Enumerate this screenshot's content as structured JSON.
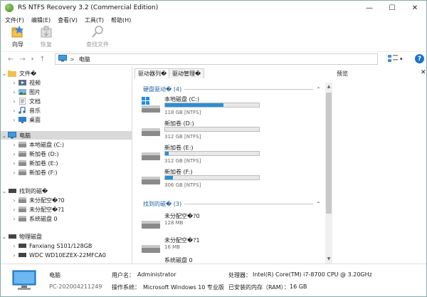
{
  "window": {
    "title": "RS NTFS Recovery 3.2 (Commercial Edition)",
    "controls": [
      "—",
      "☐",
      "✕"
    ]
  },
  "menu": [
    "文件(F)",
    "编辑(E)",
    "查看(V)",
    "工具(T)",
    "帮助(H)"
  ],
  "toolbar": {
    "wizard": "向导",
    "restore": "恢复",
    "find": "查找文件"
  },
  "address": {
    "sep": ">",
    "text": "电脑"
  },
  "tree": {
    "files": "文件�",
    "folders": [
      "视频",
      "图片",
      "文档",
      "音乐",
      "桌面"
    ],
    "computer": "电脑",
    "drives": [
      "本地磁盘 (C:)",
      "新加卷 (D:)",
      "新加卷 (E:)",
      "新加卷 (F:)"
    ],
    "found": "找到的磁�",
    "found_items": [
      "未分配空�?0",
      "未分配空�?1",
      "系统磁盘 0"
    ],
    "physical": "物理磁盘",
    "physical_items": [
      "Fanxiang S101/128GB",
      "WDC WD10EZEX-22MFCA0"
    ]
  },
  "tabs": {
    "drive_list": "驱动器列�",
    "drive_manager": "驱动管理�",
    "preview": "预览",
    "close": "✕"
  },
  "sections": {
    "drives": "硬盘驱动� (4)",
    "found": "找到的磁� (3)"
  },
  "drives": [
    {
      "name": "本地磁盘 (C:)",
      "size": "118 GB [NTFS]",
      "used": 0.62
    },
    {
      "name": "新加卷 (D:)",
      "size": "312 GB [NTFS]",
      "used": 0.0
    },
    {
      "name": "新加卷 (E:)",
      "size": "312 GB [NTFS]",
      "used": 0.04
    },
    {
      "name": "新加卷 (F:)",
      "size": "306 GB [NTFS]",
      "used": 0.08
    }
  ],
  "found_disks": [
    {
      "name": "未分配空�?0",
      "size": "128 MB",
      "used": 0.0
    },
    {
      "name": "未分配空�?1",
      "size": "16 MB",
      "used": 0.0
    },
    {
      "name": "系统磁盘 0",
      "size": "",
      "used": 0.05
    }
  ],
  "status": {
    "pc_name": "电脑",
    "pc_id": "PC-202004211249",
    "user_label": "用户名：",
    "user_value": "Administrator",
    "os_label": "操作系统：",
    "os_value": "Microsoft Windows 10 专业版",
    "cpu_label": "处理器：",
    "cpu_value": "Intel(R) Core(TM) i7-8700 CPU @ 3.20GHz",
    "ram_label": "已安装的内存（RAM）：",
    "ram_value": "16 GB"
  },
  "colors": {
    "accent": "#2a8ed6",
    "section": "#1f5fa0",
    "selected": "#d9d9d9"
  }
}
